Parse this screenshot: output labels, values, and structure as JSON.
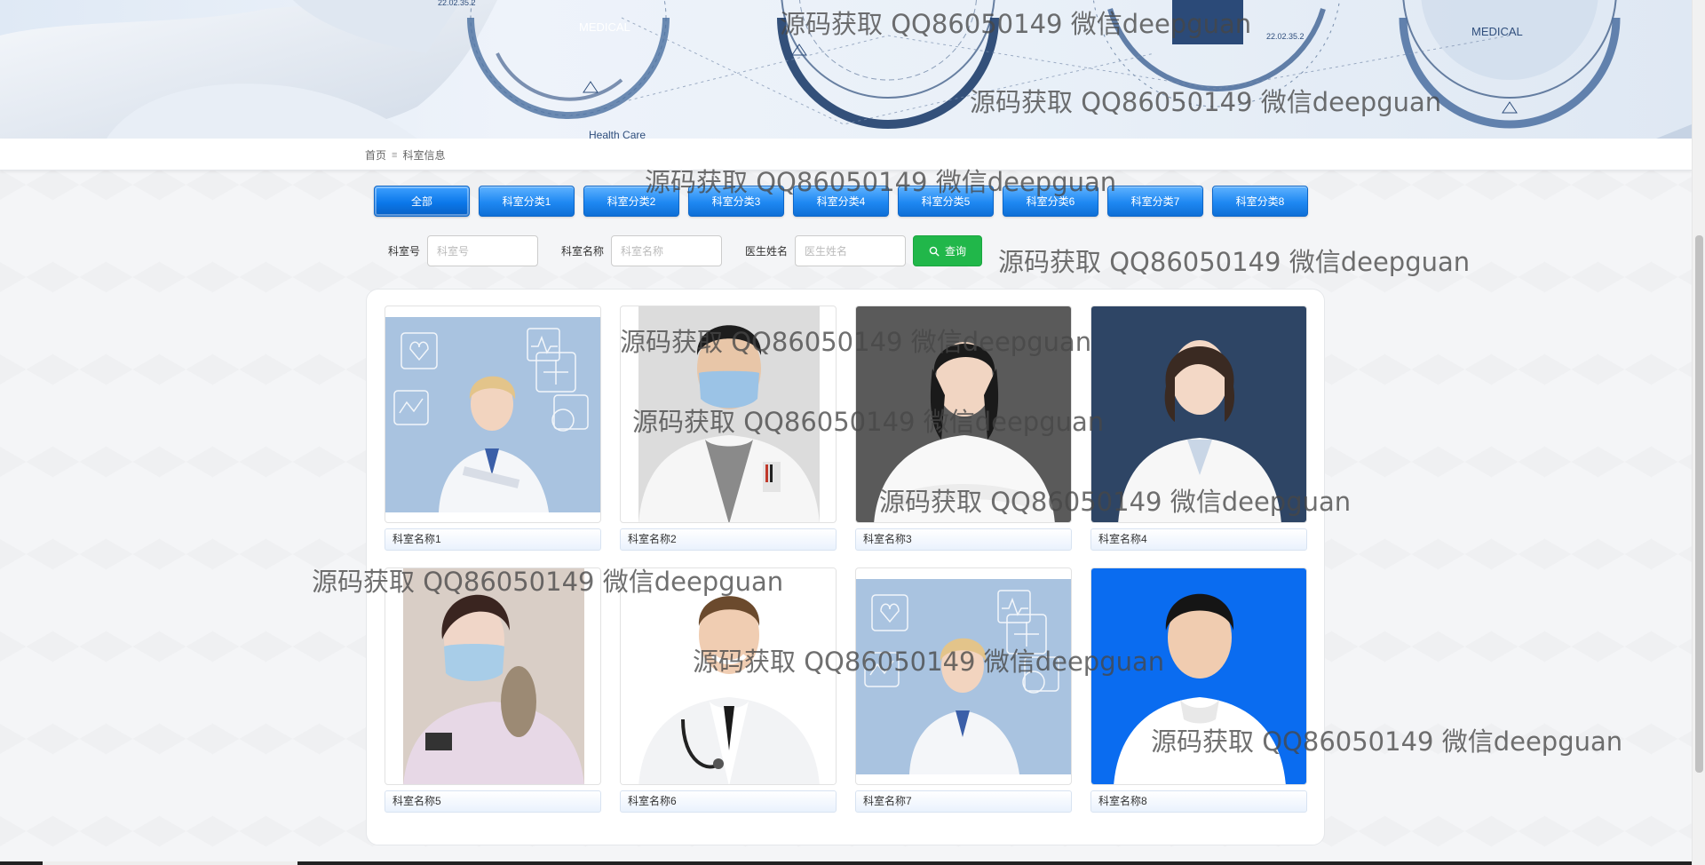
{
  "banner": {
    "medical_label_1": "MEDICAL",
    "medical_label_2": "MEDICAL",
    "health_care_label": "Health Care",
    "time_label_1": "22.02.35.2",
    "time_label_2": "22.02.35.2"
  },
  "breadcrumb": {
    "home": "首页",
    "separator": "≡",
    "current": "科室信息"
  },
  "categories": {
    "all": "全部",
    "items": [
      "科室分类1",
      "科室分类2",
      "科室分类3",
      "科室分类4",
      "科室分类5",
      "科室分类6",
      "科室分类7",
      "科室分类8"
    ],
    "active_color": "#0b78ea"
  },
  "search": {
    "room_no_label": "科室号",
    "room_no_placeholder": "科室号",
    "room_name_label": "科室名称",
    "room_name_placeholder": "科室名称",
    "doctor_label": "医生姓名",
    "doctor_placeholder": "医生姓名",
    "query_label": "查询",
    "query_icon": "search-icon",
    "query_color": "#21b74a"
  },
  "cards": [
    {
      "name": "科室名称1"
    },
    {
      "name": "科室名称2"
    },
    {
      "name": "科室名称3"
    },
    {
      "name": "科室名称4"
    },
    {
      "name": "科室名称5"
    },
    {
      "name": "科室名称6"
    },
    {
      "name": "科室名称7"
    },
    {
      "name": "科室名称8"
    }
  ],
  "watermark": "源码获取 QQ86050149 微信deepguan"
}
